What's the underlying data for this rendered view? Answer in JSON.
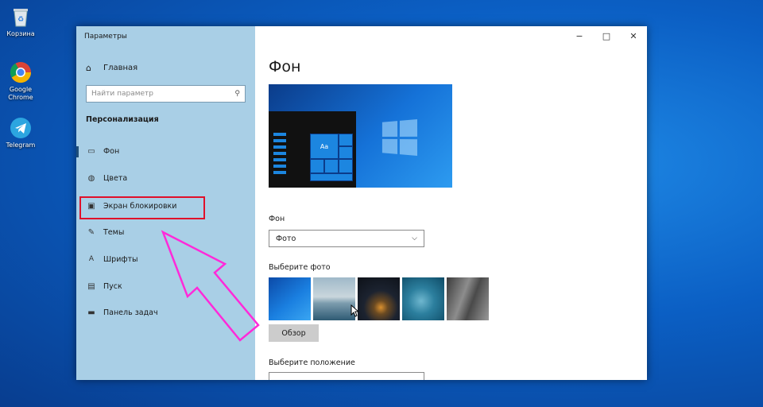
{
  "desktop": {
    "icons": [
      {
        "label": "Корзина",
        "icon": "recycle-bin-icon"
      },
      {
        "label": "Google Chrome",
        "icon": "chrome-icon"
      },
      {
        "label": "Telegram",
        "icon": "telegram-icon"
      }
    ]
  },
  "window": {
    "title": "Параметры",
    "controls": {
      "minimize": "−",
      "maximize": "□",
      "close": "✕"
    }
  },
  "sidebar": {
    "home_label": "Главная",
    "search_placeholder": "Найти параметр",
    "section_title": "Персонализация",
    "items": [
      {
        "label": "Фон",
        "icon": "image-icon"
      },
      {
        "label": "Цвета",
        "icon": "palette-icon"
      },
      {
        "label": "Экран блокировки",
        "icon": "lock-screen-icon"
      },
      {
        "label": "Темы",
        "icon": "brush-icon"
      },
      {
        "label": "Шрифты",
        "icon": "font-icon"
      },
      {
        "label": "Пуск",
        "icon": "start-icon"
      },
      {
        "label": "Панель задач",
        "icon": "taskbar-icon"
      }
    ]
  },
  "main": {
    "title": "Фон",
    "preview_tile_text": "Aa",
    "background_label": "Фон",
    "background_value": "Фото",
    "choose_photo_label": "Выберите фото",
    "browse_label": "Обзор",
    "choose_position_label": "Выберите положение"
  },
  "colors": {
    "highlight": "#e0102a",
    "annotation_arrow": "#ff2ad9",
    "sidebar_bg": "#a9cfe6"
  }
}
